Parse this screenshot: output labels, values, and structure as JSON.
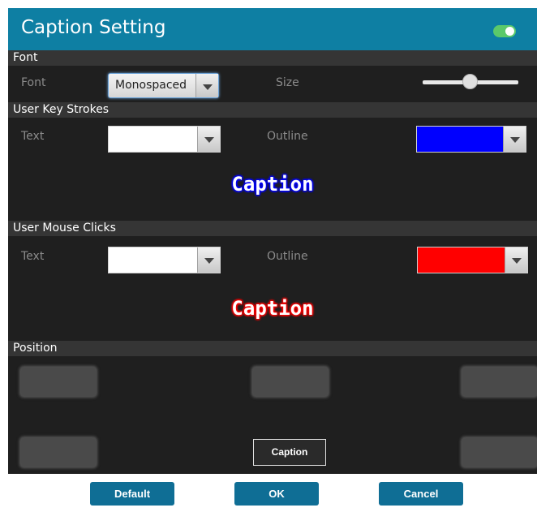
{
  "window": {
    "title": "Caption Setting",
    "toggle_on": true,
    "toggle_color": "#5bc96a",
    "accent": "#0e7fa3"
  },
  "font": {
    "header": "Font",
    "font_label": "Font",
    "font_value": "Monospaced",
    "size_label": "Size",
    "size_level": 0.5
  },
  "keystrokes": {
    "header": "User Key Strokes",
    "text_label": "Text",
    "text_color": "#ffffff",
    "outline_label": "Outline",
    "outline_color": "#0000ff",
    "preview": "Caption"
  },
  "mouse": {
    "header": "User Mouse Clicks",
    "text_label": "Text",
    "text_color": "#ffffff",
    "outline_label": "Outline",
    "outline_color": "#ff0000",
    "preview": "Caption"
  },
  "position": {
    "header": "Position",
    "selected_label": "Caption"
  },
  "footer": {
    "default_label": "Default",
    "ok_label": "OK",
    "cancel_label": "Cancel"
  }
}
